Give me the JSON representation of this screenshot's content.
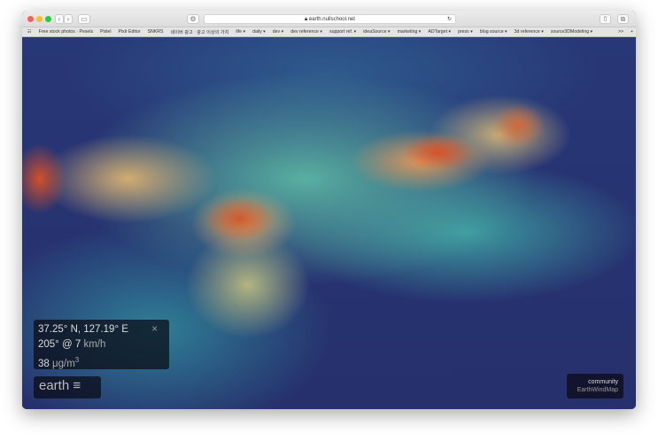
{
  "browser": {
    "url": "earth.nullschool.net",
    "bookmarks": [
      "Free stock photos · Pexels",
      "Pixlel",
      "Pixlr Editor",
      "SNKRS",
      "네이버 광고 : 광고 이상의 가치",
      "life ▾",
      "daily ▾",
      "dev ▾",
      "dev reference ▾",
      "support ref. ▾",
      "ideaSource ▾",
      "marketing ▾",
      "ADTarget ▾",
      "press ▾",
      "blog source ▾",
      "3d reference ▾",
      "source3DModeling ▾"
    ],
    "overflow": ">>",
    "add": "+"
  },
  "info": {
    "coords": "37.25° N, 127.19° E",
    "close": "×",
    "wind_value": "205° @ 7",
    "wind_unit": "km/h",
    "pm_value": "38",
    "pm_unit": "μg/m",
    "pm_sup": "3"
  },
  "logo": {
    "text": "earth",
    "menu": "≡"
  },
  "community": {
    "label": "community",
    "name": "EarthWindMap"
  }
}
